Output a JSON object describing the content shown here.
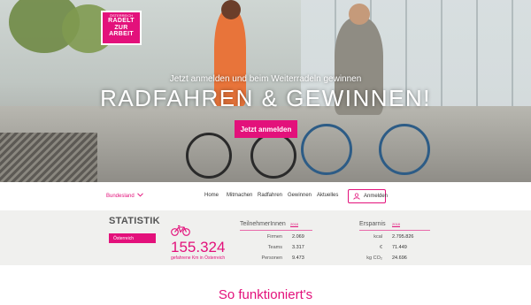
{
  "hero": {
    "logo": {
      "top": "ÖSTERREICH",
      "lines": [
        "RADELT",
        "ZUR",
        "ARBEIT"
      ]
    },
    "subtitle": "Jetzt anmelden und beim Weiterradeln gewinnen",
    "title": "RADFAHREN & GEWINNEN!",
    "cta": "Jetzt anmelden"
  },
  "nav": {
    "region": "Bundesland",
    "items": [
      "Home",
      "Mitmachen",
      "Radfahren",
      "Gewinnen",
      "Aktuelles"
    ],
    "login": "Anmelden"
  },
  "stats": {
    "title": "STATISTIK",
    "region": "Österreich",
    "km": "155.324",
    "km_caption": "gefahrene Km in Österreich",
    "participants": {
      "title": "TeilnehmerInnen",
      "year": "2018",
      "rows": [
        {
          "label": "Firmen",
          "value": "2.069"
        },
        {
          "label": "Teams",
          "value": "3.317"
        },
        {
          "label": "Personen",
          "value": "9.473"
        }
      ]
    },
    "savings": {
      "title": "Ersparnis",
      "year": "2018",
      "rows": [
        {
          "label": "kcal",
          "value": "2.795.826"
        },
        {
          "label": "€",
          "value": "71.449"
        },
        {
          "label": "kg CO₂",
          "value": "24.696"
        }
      ]
    }
  },
  "section": {
    "title": "So funktioniert's"
  },
  "colors": {
    "accent": "#e3117b",
    "stats_bg": "#f0f0ee"
  }
}
